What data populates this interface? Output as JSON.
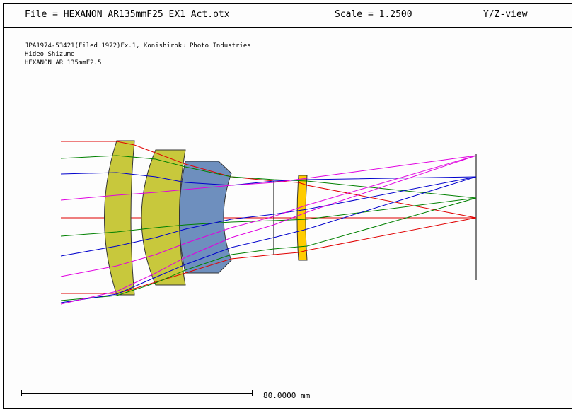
{
  "header": {
    "file": "File = HEXANON AR135mmF25 EX1 Act.otx",
    "scale": "Scale = 1.2500",
    "view": "Y/Z-view"
  },
  "notes": [
    "JPA1974-53421(Filed 1972)Ex.1, Konishiroku Photo Industries",
    "Hideo Shizume",
    "HEXANON AR 135mmF2.5"
  ],
  "scalebar": {
    "label": "80.0000 mm"
  },
  "colors": {
    "lens_olive": "#c8c83c",
    "lens_blue": "#6e8fbe",
    "lens_yellow": "#ffcc00",
    "ray_red": "#e00000",
    "ray_green": "#008000",
    "ray_blue": "#0000cc",
    "ray_magenta": "#e000e0"
  }
}
